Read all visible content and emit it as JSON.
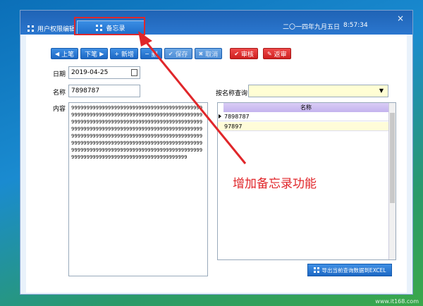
{
  "window": {
    "close": "×",
    "tabs": [
      {
        "label": "用户权限编辑"
      },
      {
        "label": "备忘录"
      }
    ],
    "date": "二〇一四年九月五日",
    "time": "8:57:34"
  },
  "toolbar": {
    "prev": "上笔",
    "next": "下笔",
    "add": "新增",
    "del": "删",
    "save": "保存",
    "cancel": "取消",
    "audit": "审核",
    "revert": "返审"
  },
  "form": {
    "date_label": "日期",
    "date_value": "2019-04-25",
    "name_label": "名称",
    "name_value": "7898787",
    "content_label": "内容",
    "content_value": "999999999999999999999999999999999999999999999999999999999999999999999999999999999999999999999999999999999999999999999999999999999999999999999999999999999999999999999999999999999999999999999999999999999999999999999999999999999999999999999999999999999999999999999999999999999999999999999999999999999999999999999999999999999999999999999999999",
    "query_label": "按名称查询",
    "query_value": ""
  },
  "grid": {
    "column": "名称",
    "rows": [
      "7898787",
      "97897"
    ]
  },
  "export": {
    "label": "导出当前查询数据到EXCEL"
  },
  "annotation": {
    "text": "增加备忘录功能"
  },
  "watermark": "www.it168.com",
  "colors": {
    "accent": "#1f6fcc",
    "alert": "#e0262a"
  }
}
